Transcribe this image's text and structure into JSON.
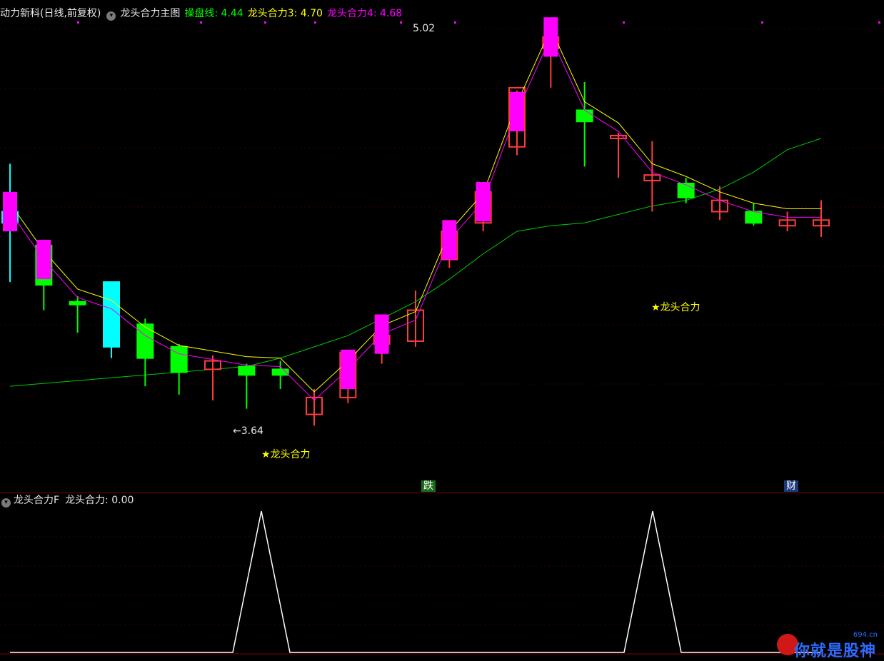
{
  "header": {
    "stock_name": "动力新科(日线,前复权)",
    "indicator_name": "龙头合力主图",
    "line1_label": "操盘线: 4.44",
    "line2_label": "龙头合力3: 4.70",
    "line3_label": "龙头合力4: 4.68"
  },
  "sub_header": {
    "indicator_name": "龙头合力F",
    "value_label": "龙头合力: 0.00"
  },
  "annotations": {
    "high_label": "5.02",
    "low_label": "←3.64",
    "signal_1": "★龙头合力",
    "signal_2": "★龙头合力",
    "tag_fall": "跌",
    "tag_finance": "财"
  },
  "watermark": {
    "text": "你就是股神",
    "site": "694.cn"
  },
  "colors": {
    "up": "#ff3c3c",
    "down_cyan": "#00ffff",
    "down_green": "#00ff00",
    "magenta": "#ff00ff",
    "yellow": "#ffff00",
    "ma_green": "#00cc00"
  },
  "chart_data": {
    "type": "candlestick",
    "series": [
      {
        "name": "candles",
        "ohlc": [
          [
            4.4,
            4.57,
            4.15,
            4.36
          ],
          [
            4.28,
            4.3,
            4.05,
            4.14
          ],
          [
            4.08,
            4.1,
            3.97,
            4.07
          ],
          [
            4.15,
            4.15,
            3.88,
            3.92
          ],
          [
            4.0,
            4.02,
            3.78,
            3.88
          ],
          [
            3.92,
            3.93,
            3.75,
            3.83
          ],
          [
            3.84,
            3.89,
            3.73,
            3.87
          ],
          [
            3.85,
            3.86,
            3.7,
            3.82
          ],
          [
            3.84,
            3.87,
            3.77,
            3.82
          ],
          [
            3.68,
            3.77,
            3.64,
            3.74
          ],
          [
            3.74,
            3.9,
            3.72,
            3.9
          ],
          [
            3.93,
            4.0,
            3.86,
            3.96
          ],
          [
            3.94,
            4.12,
            3.92,
            4.05
          ],
          [
            4.23,
            4.3,
            4.2,
            4.33
          ],
          [
            4.36,
            4.44,
            4.33,
            4.47
          ],
          [
            4.63,
            4.83,
            4.6,
            4.84
          ],
          [
            4.98,
            4.99,
            4.84,
            5.02
          ],
          [
            4.76,
            4.86,
            4.56,
            4.72
          ],
          [
            4.66,
            4.68,
            4.52,
            4.67
          ],
          [
            4.51,
            4.65,
            4.4,
            4.53
          ],
          [
            4.5,
            4.52,
            4.43,
            4.45
          ],
          [
            4.4,
            4.49,
            4.37,
            4.44
          ],
          [
            4.4,
            4.43,
            4.35,
            4.36
          ],
          [
            4.35,
            4.4,
            4.33,
            4.37
          ],
          [
            4.35,
            4.44,
            4.31,
            4.37
          ]
        ]
      }
    ]
  }
}
